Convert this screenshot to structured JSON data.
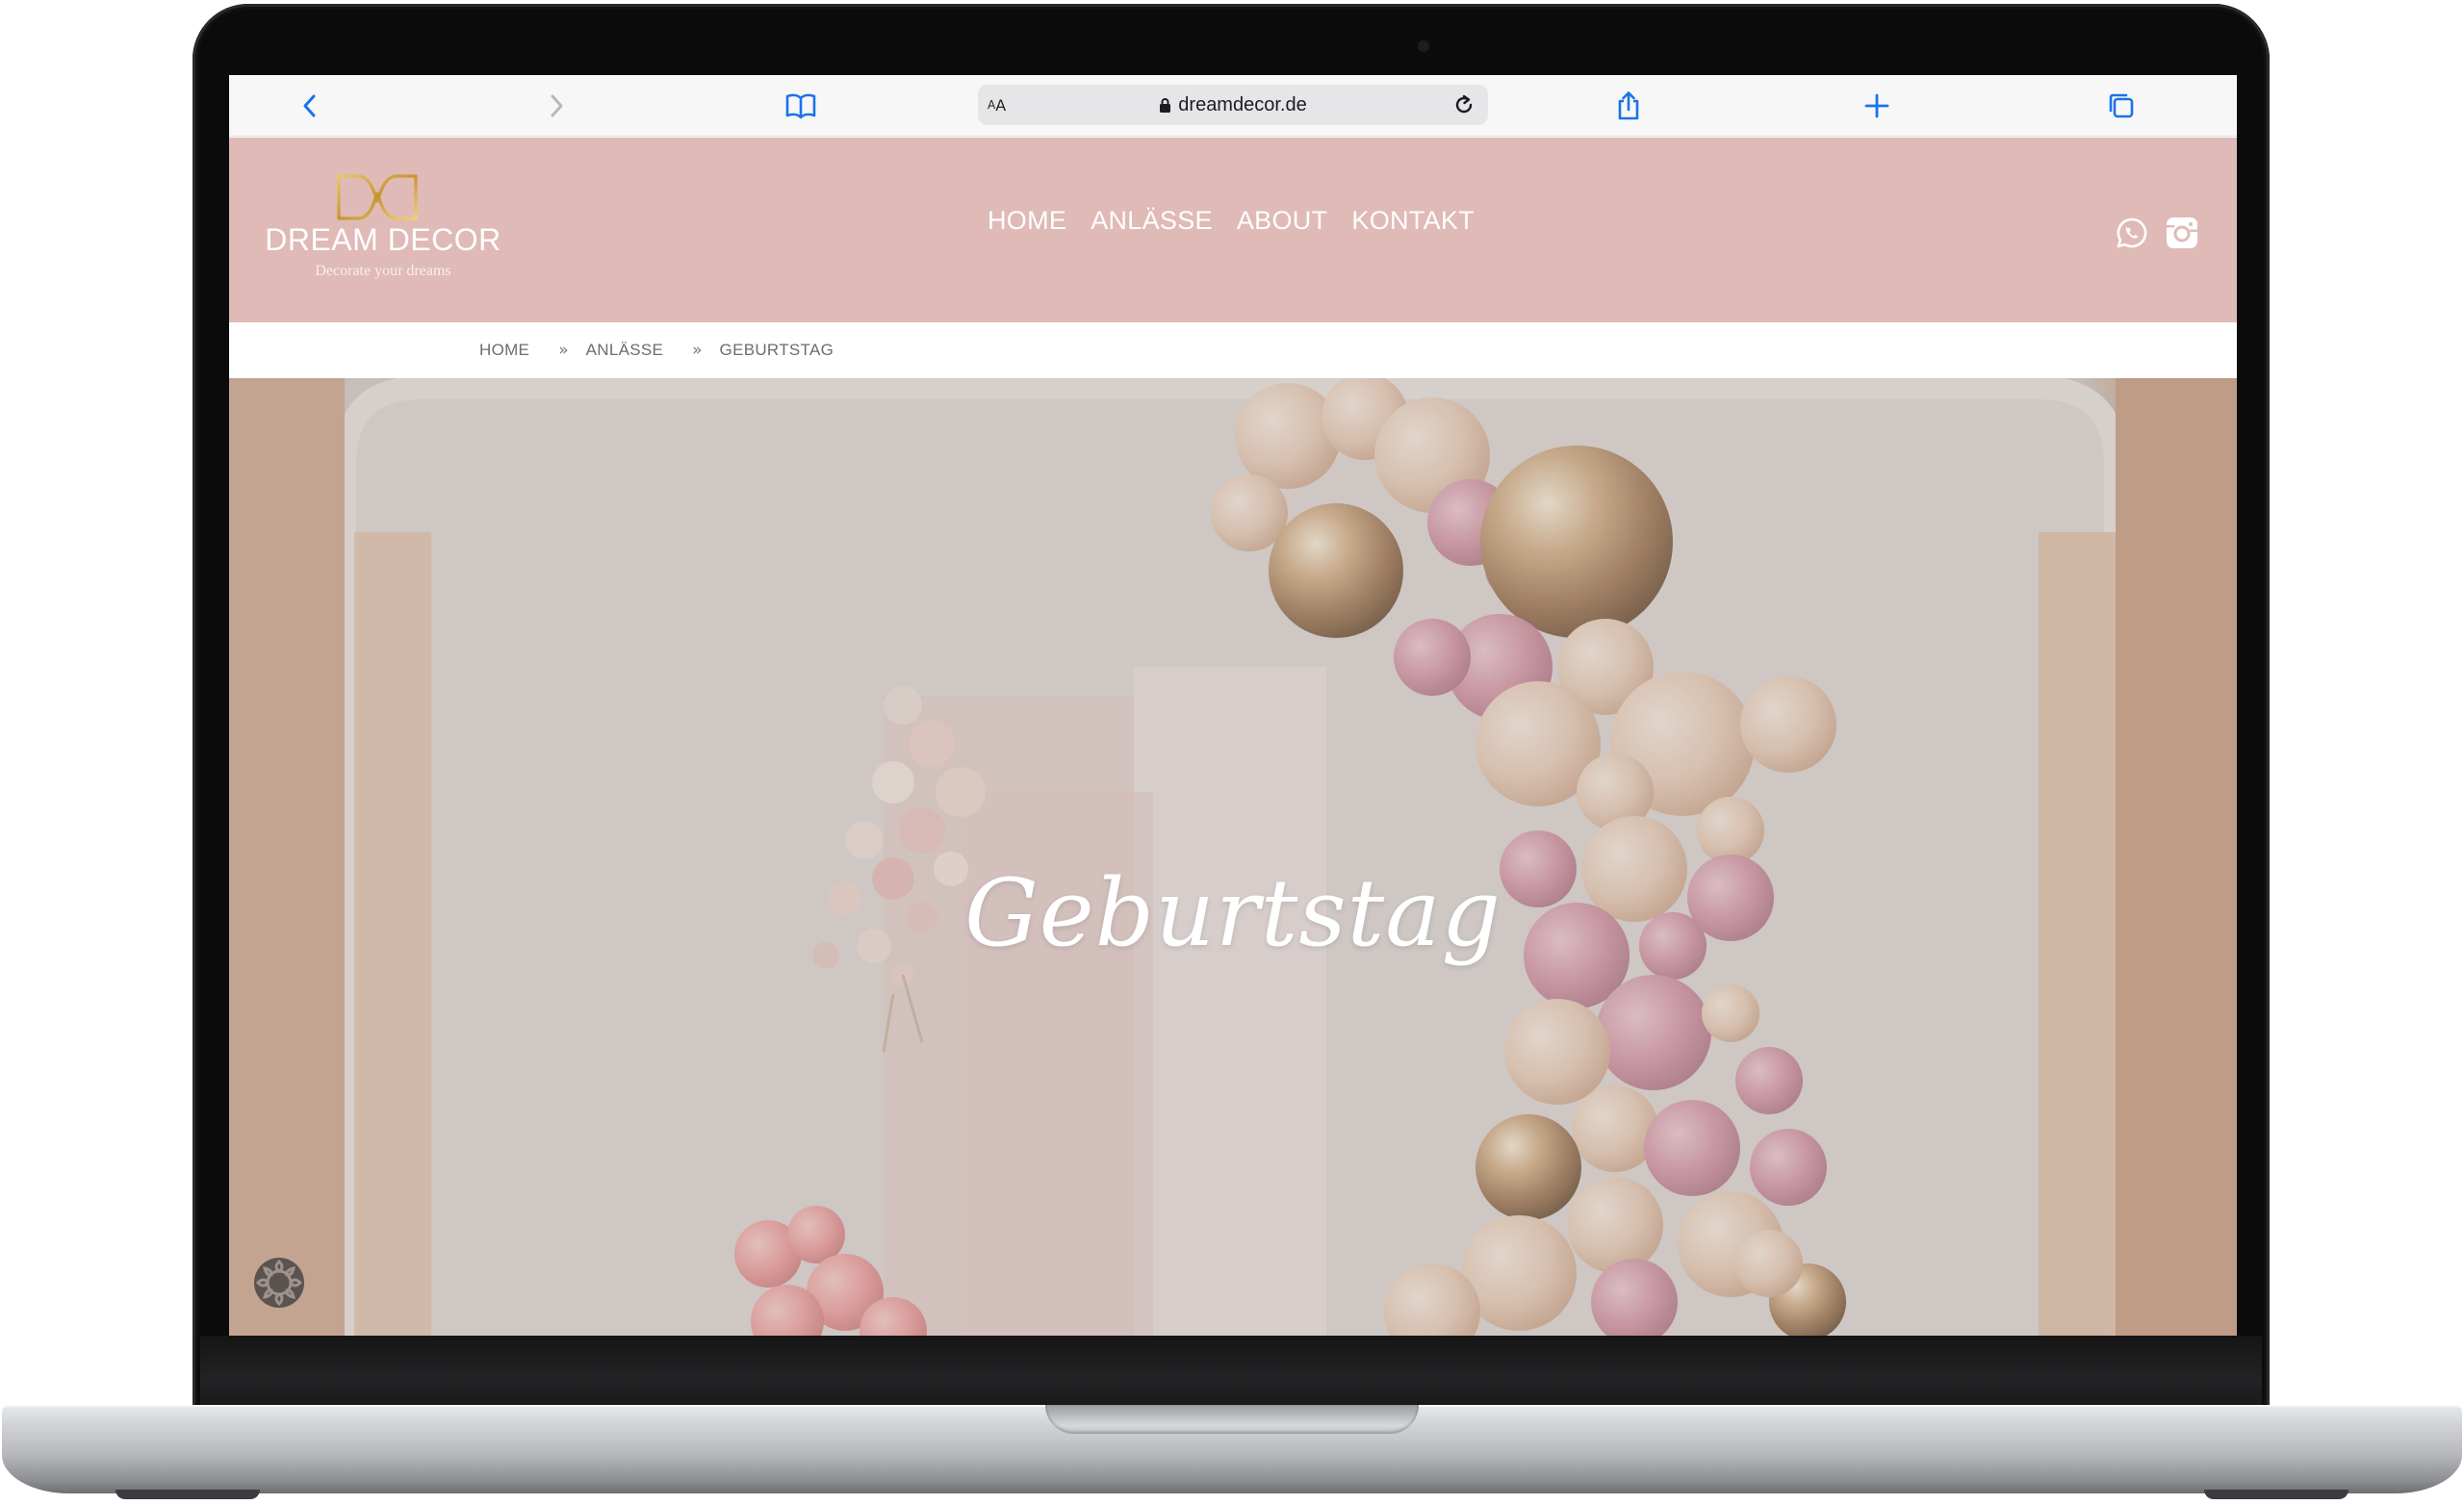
{
  "browser": {
    "url": "dreamdecor.de",
    "reader_small": "A",
    "reader_big": "A",
    "accent_color": "#1a73e8"
  },
  "site": {
    "brand_name": "DREAM DECOR",
    "tagline": "Decorate your dreams",
    "header_color": "#dfbab7",
    "nav": [
      {
        "label": "HOME"
      },
      {
        "label": "ANLÄSSE"
      },
      {
        "label": "ABOUT"
      },
      {
        "label": "KONTAKT"
      }
    ],
    "social": [
      {
        "icon": "whatsapp-icon"
      },
      {
        "icon": "instagram-icon"
      }
    ]
  },
  "breadcrumb": {
    "items": [
      "HOME",
      "ANLÄSSE",
      "GEBURTSTAG"
    ],
    "separator": "»"
  },
  "hero": {
    "title": "Geburtstag"
  }
}
